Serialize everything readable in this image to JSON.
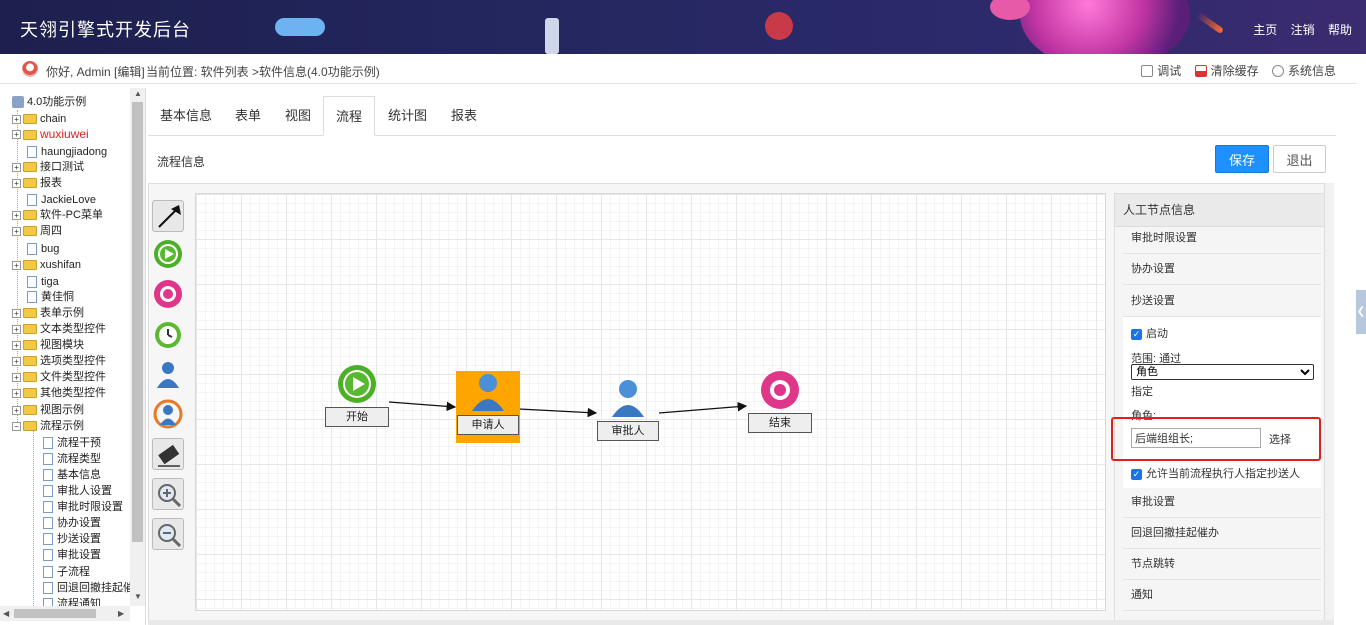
{
  "header": {
    "title": "天翎引擎式开发后台",
    "links": [
      "主页",
      "注销",
      "帮助"
    ]
  },
  "subbar": {
    "greeting": "你好, Admin",
    "edit": "[编辑]",
    "breadcrumb": "当前位置: 软件列表 >软件信息(4.0功能示例)",
    "tools": [
      "调试",
      "清除缓存",
      "系统信息"
    ]
  },
  "tree": {
    "root": "4.0功能示例",
    "items": [
      "chain",
      "wuxiuwei",
      "haungjiadong",
      "接口测试",
      "报表",
      "JackieLove",
      "软件-PC菜单",
      "周四",
      "bug",
      "xushifan",
      "tiga",
      "黄佳恫",
      "表单示例",
      "文本类型控件",
      "视图模块",
      "选项类型控件",
      "文件类型控件",
      "其他类型控件",
      "视图示例",
      "流程示例"
    ],
    "children": [
      "流程干预",
      "流程类型",
      "基本信息",
      "审批人设置",
      "审批时限设置",
      "协办设置",
      "抄送设置",
      "审批设置",
      "子流程",
      "回退回撤挂起催办",
      "流程通知"
    ]
  },
  "tabs": [
    "基本信息",
    "表单",
    "视图",
    "流程",
    "统计图",
    "报表"
  ],
  "active_tab": "流程",
  "section_label": "流程信息",
  "buttons": {
    "save": "保存",
    "exit": "退出"
  },
  "flow": {
    "nodes": {
      "start": "开始",
      "applicant": "申请人",
      "approver": "审批人",
      "end": "结束"
    }
  },
  "panel": {
    "title": "人工节点信息",
    "rows_top": [
      "审批时限设置",
      "协办设置",
      "抄送设置"
    ],
    "enable_label": "启动",
    "scope_label": "范围: 通过",
    "role_option": "角色",
    "assign_label": "指定",
    "role_label": "角色:",
    "role_value": "后端组组长;",
    "choose": "选择",
    "allow_label": "允许当前流程执行人指定抄送人",
    "rows_bottom": [
      "审批设置",
      "回退回撤挂起催办",
      "节点跳转",
      "通知"
    ]
  }
}
